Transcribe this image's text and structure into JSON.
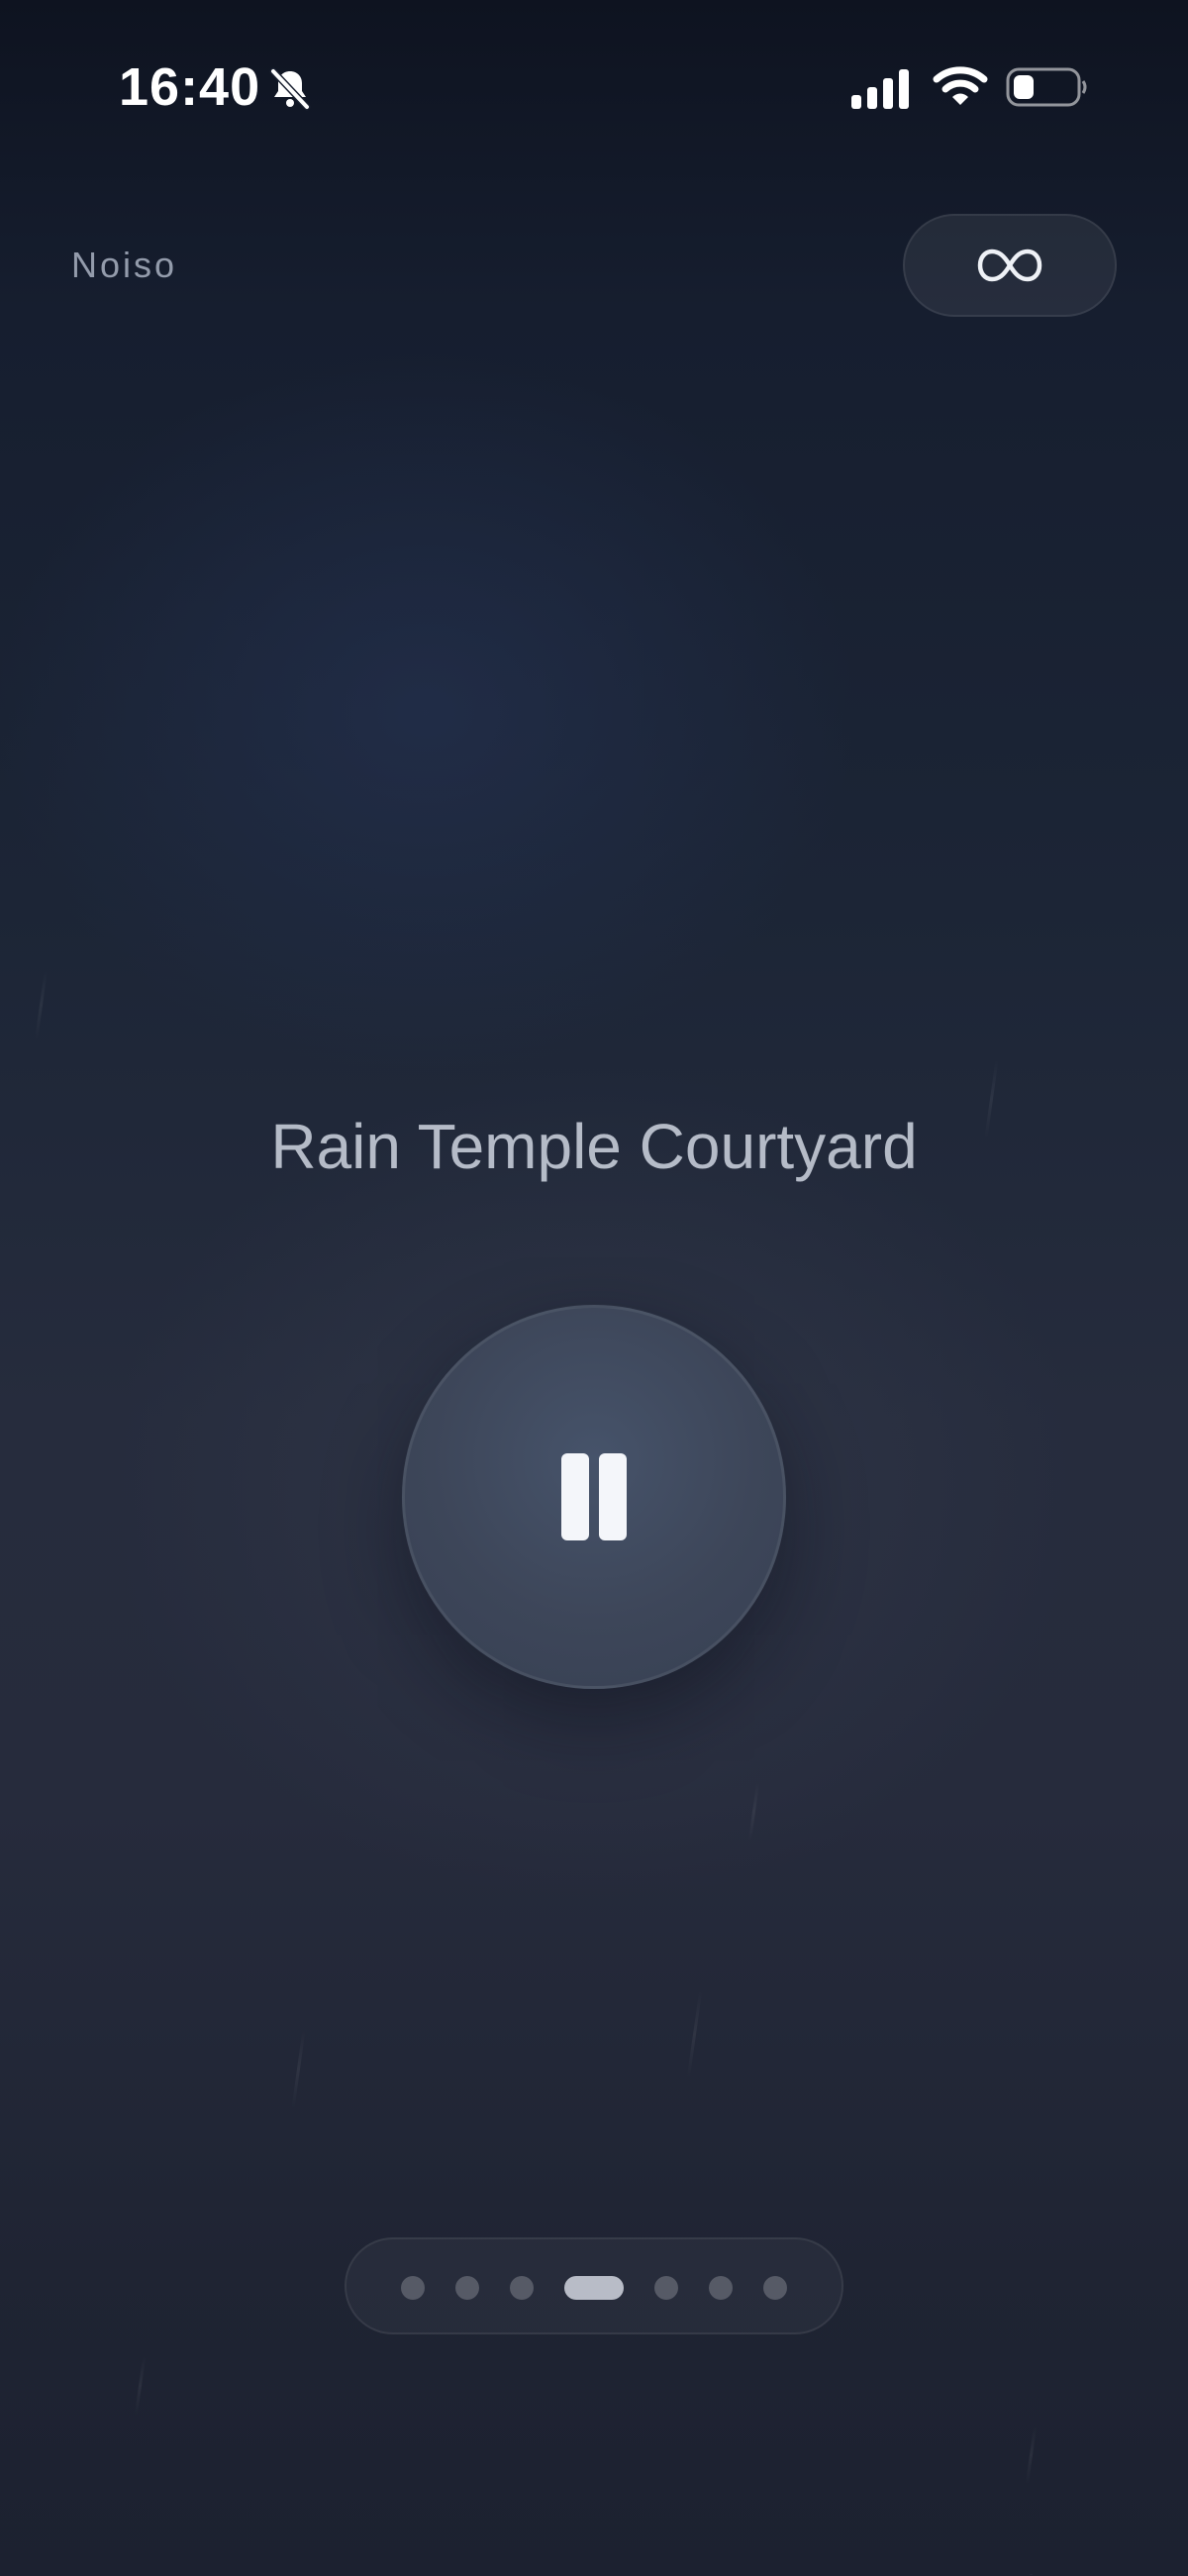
{
  "status_bar": {
    "time": "16:40",
    "icons": [
      "bell-slash-icon",
      "cellular-signal-icon",
      "wifi-icon",
      "battery-low-icon"
    ]
  },
  "header": {
    "app_name": "Noiso",
    "loop_button_icon": "infinity-icon"
  },
  "player": {
    "track_title": "Rain Temple Courtyard",
    "state_icon": "pause-icon"
  },
  "pager": {
    "count": 7,
    "active_index": 3
  },
  "colors": {
    "background_top": "#0e1320",
    "background_mid": "#262c3d",
    "button_fill": "#3d4659",
    "text_primary": "#ffffff"
  }
}
